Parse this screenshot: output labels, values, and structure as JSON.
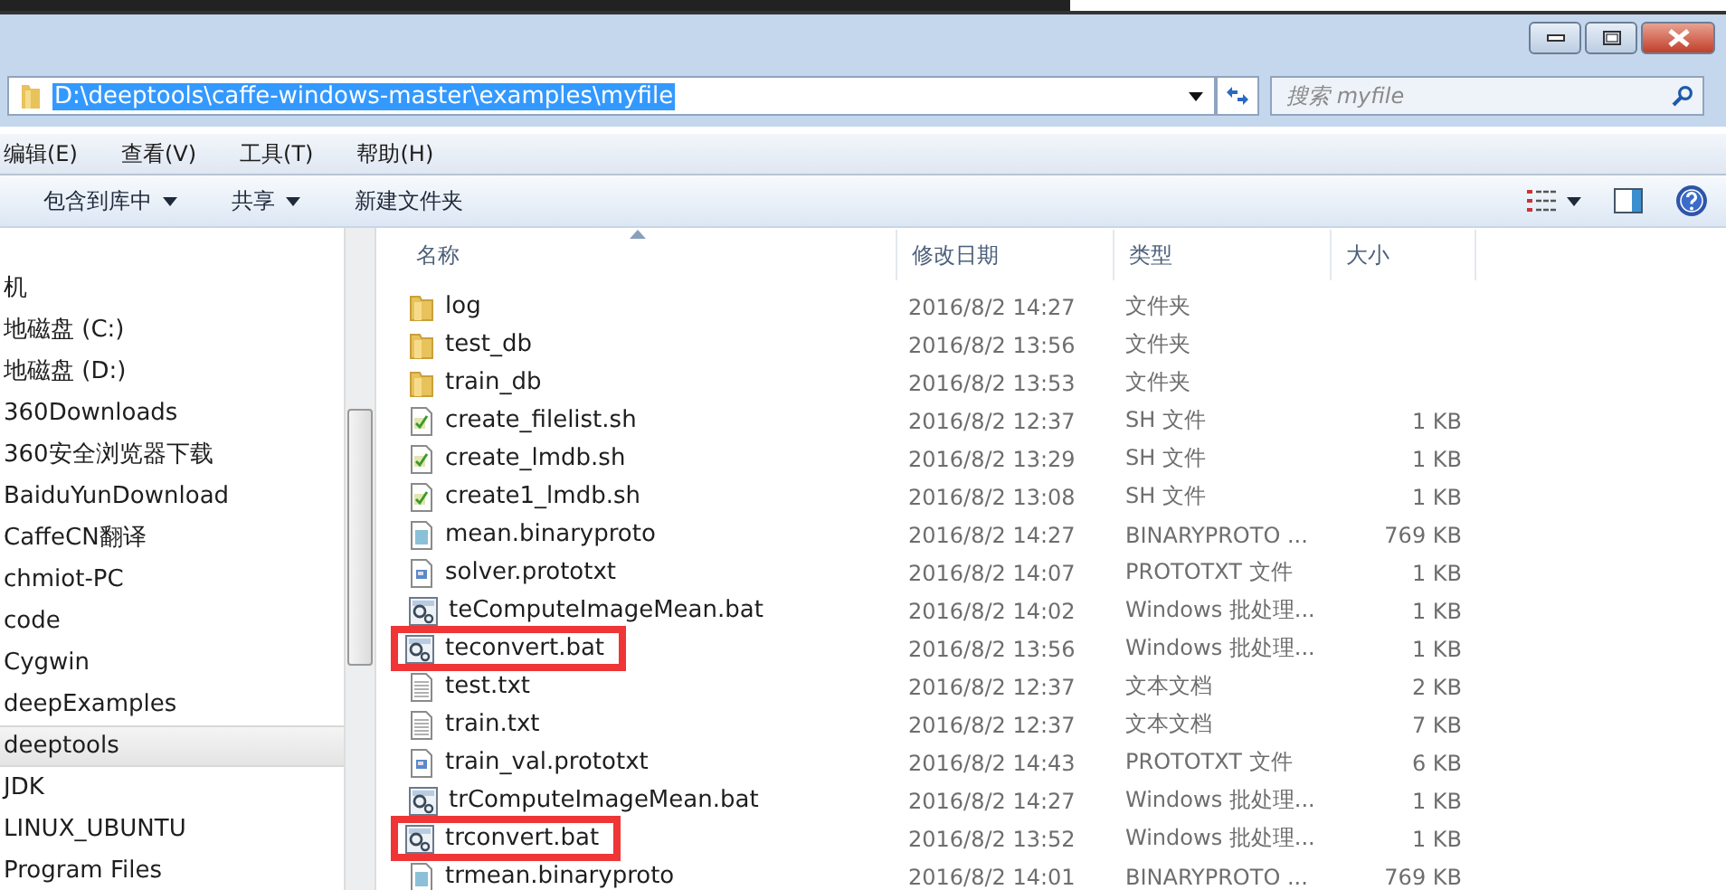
{
  "address_bar": {
    "path": "D:\\deeptools\\caffe-windows-master\\examples\\myfile"
  },
  "search": {
    "placeholder": "搜索 myfile"
  },
  "menu": [
    "编辑(E)",
    "查看(V)",
    "工具(T)",
    "帮助(H)"
  ],
  "toolbar": [
    {
      "label": "包含到库中",
      "dropdown": true
    },
    {
      "label": "共享",
      "dropdown": true
    },
    {
      "label": "新建文件夹",
      "dropdown": false
    }
  ],
  "sidebar": {
    "items": [
      {
        "label": "机",
        "selected": false
      },
      {
        "label": "地磁盘 (C:)",
        "selected": false
      },
      {
        "label": "地磁盘 (D:)",
        "selected": false
      },
      {
        "label": "360Downloads",
        "selected": false
      },
      {
        "label": "360安全浏览器下载",
        "selected": false
      },
      {
        "label": "BaiduYunDownload",
        "selected": false
      },
      {
        "label": "CaffeCN翻译",
        "selected": false
      },
      {
        "label": "chmiot-PC",
        "selected": false
      },
      {
        "label": "code",
        "selected": false
      },
      {
        "label": "Cygwin",
        "selected": false
      },
      {
        "label": "deepExamples",
        "selected": false
      },
      {
        "label": "deeptools",
        "selected": true
      },
      {
        "label": "JDK",
        "selected": false
      },
      {
        "label": "LINUX_UBUNTU",
        "selected": false
      },
      {
        "label": "Program Files",
        "selected": false
      }
    ]
  },
  "file_list": {
    "columns": [
      {
        "label": "名称",
        "sorted": true
      },
      {
        "label": "修改日期",
        "sorted": false
      },
      {
        "label": "类型",
        "sorted": false
      },
      {
        "label": "大小",
        "sorted": false
      }
    ],
    "rows": [
      {
        "kind": "folder",
        "name": "log",
        "modified": "2016/8/2 14:27",
        "type": "文件夹",
        "highlighted": false
      },
      {
        "kind": "folder",
        "name": "test_db",
        "modified": "2016/8/2 13:56",
        "type": "文件夹",
        "highlighted": false
      },
      {
        "kind": "folder",
        "name": "train_db",
        "modified": "2016/8/2 13:53",
        "type": "文件夹",
        "highlighted": false
      },
      {
        "kind": "script",
        "name": "create_filelist.sh",
        "modified": "2016/8/2 12:37",
        "type": "SH 文件",
        "size": "1 KB",
        "highlighted": false
      },
      {
        "kind": "script",
        "name": "create_lmdb.sh",
        "modified": "2016/8/2 13:29",
        "type": "SH 文件",
        "size": "1 KB",
        "highlighted": false
      },
      {
        "kind": "script",
        "name": "create1_lmdb.sh",
        "modified": "2016/8/2 13:08",
        "type": "SH 文件",
        "size": "1 KB",
        "highlighted": false
      },
      {
        "kind": "binary",
        "name": "mean.binaryproto",
        "modified": "2016/8/2 14:27",
        "type": "BINARYPROTO ...",
        "size": "769 KB",
        "highlighted": false
      },
      {
        "kind": "image",
        "name": "solver.prototxt",
        "modified": "2016/8/2 14:07",
        "type": "PROTOTXT 文件",
        "size": "1 KB",
        "highlighted": false
      },
      {
        "kind": "batch",
        "name": "teComputeImageMean.bat",
        "modified": "2016/8/2 14:02",
        "type": "Windows 批处理...",
        "size": "1 KB",
        "highlighted": false
      },
      {
        "kind": "batch",
        "name": "teconvert.bat",
        "modified": "2016/8/2 13:56",
        "type": "Windows 批处理...",
        "size": "1 KB",
        "highlighted": true
      },
      {
        "kind": "text",
        "name": "test.txt",
        "modified": "2016/8/2 12:37",
        "type": "文本文档",
        "size": "2 KB",
        "highlighted": false
      },
      {
        "kind": "text",
        "name": "train.txt",
        "modified": "2016/8/2 12:37",
        "type": "文本文档",
        "size": "7 KB",
        "highlighted": false
      },
      {
        "kind": "image",
        "name": "train_val.prototxt",
        "modified": "2016/8/2 14:43",
        "type": "PROTOTXT 文件",
        "size": "6 KB",
        "highlighted": false
      },
      {
        "kind": "batch",
        "name": "trComputeImageMean.bat",
        "modified": "2016/8/2 14:27",
        "type": "Windows 批处理...",
        "size": "1 KB",
        "highlighted": false
      },
      {
        "kind": "batch",
        "name": "trconvert.bat",
        "modified": "2016/8/2 13:52",
        "type": "Windows 批处理...",
        "size": "1 KB",
        "highlighted": true
      },
      {
        "kind": "binary",
        "name": "trmean.binaryproto",
        "modified": "2016/8/2 14:01",
        "type": "BINARYPROTO ...",
        "size": "769 KB",
        "highlighted": false
      }
    ]
  }
}
